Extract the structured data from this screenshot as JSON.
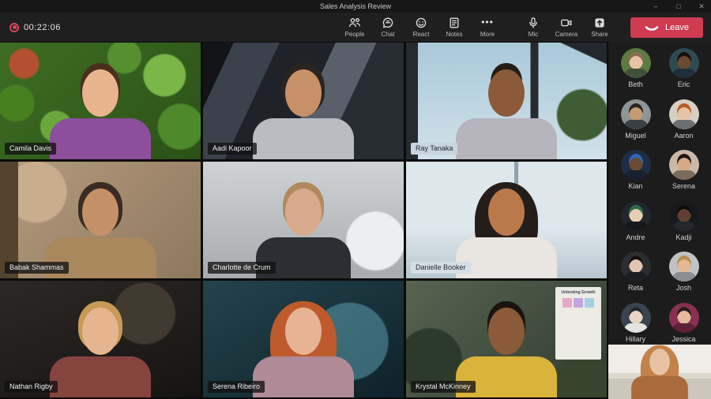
{
  "window": {
    "title": "Sales Analysis Review",
    "minimize": "–",
    "maximize": "□",
    "close": "✕"
  },
  "colors": {
    "leave_red": "#cf3b50",
    "record_red": "#d5495b",
    "titlebar_bg": "#171717",
    "toolbar_bg": "#1f1f1f"
  },
  "toolbar": {
    "timer": "00:22:06",
    "record_ring_style": "border-color:#d5495b",
    "record_dot_style": "background:#d5495b",
    "items": [
      {
        "label": "People",
        "icon": "people-icon"
      },
      {
        "label": "Chat",
        "icon": "chat-icon"
      },
      {
        "label": "React",
        "icon": "react-icon"
      },
      {
        "label": "Notes",
        "icon": "notes-icon"
      },
      {
        "label": "More",
        "icon": "more-icon",
        "glyph": "•••"
      }
    ],
    "devices": [
      {
        "label": "Mic",
        "icon": "mic-icon"
      },
      {
        "label": "Camera",
        "icon": "camera-icon"
      },
      {
        "label": "Share",
        "icon": "share-icon"
      }
    ],
    "leave_label": "Leave",
    "leave_style": "background:#cf3b50"
  },
  "grid": {
    "whiteboard_title": "Unlocking Growth",
    "tiles": [
      {
        "name": "Camila Davis",
        "style": "--scene:radial-gradient(circle at 12% 18%, #b2502f 0%, #b2502f 7%, rgba(0,0,0,0) 8%),radial-gradient(circle at 82% 28%, #7ab648 0%, #7ab648 11%, rgba(0,0,0,0) 12%),radial-gradient(circle at 28% 72%, #6aa83e 0%, #6aa83e 9%, rgba(0,0,0,0) 10%),radial-gradient(circle at 62% 12%, #558f2f 0%, #558f2f 10%, rgba(0,0,0,0) 11%),radial-gradient(circle at 90% 72%, #4e8a2c 0%, #4e8a2c 11%, rgba(0,0,0,0) 12%),radial-gradient(circle at 8% 52%, #47801f 0%, #47801f 9%, rgba(0,0,0,0) 10%),linear-gradient(135deg,#3e6d23,#2b5117);--skin:#e9b48d;--hair:#4a2f1d;--hairw:50px;--hairh:62px;--shirt:#8d4e9c"
      },
      {
        "name": "Aadi Kapoor",
        "style": "--scene:linear-gradient(115deg,#121418 0%,#121418 12%,#3c424b 12%,#3c424b 30%,#1f2329 30%,#1f2329 52%,#5a6069 52%,#5a6069 68%,#282c33 68%,#282c33 100%);--skin:#c89067;--hair:#2b2420;--hairw:54px;--hairh:64px;--shirt:#b9bdc2"
      },
      {
        "name": "Ray Tanaka",
        "style": "--scene:linear-gradient(90deg,#262b30 0%,#262b30 6%,rgba(0,0,0,0) 6%,rgba(0,0,0,0) 62%,#262b30 62%,#262b30 66%,rgba(0,0,0,0) 66%),linear-gradient(205deg,#23282e 0%,#23282e 10%,rgba(0,0,0,0) 10.5%),radial-gradient(circle at 88% 62%, #3f5d35 0%, #3f5d35 13%, rgba(0,0,0,0) 14%),linear-gradient(180deg,#a9c9d9,#d0e1e9);--skin:#8a5a3b;--hair:#241d16;--hairw:40px;--hairh:48px;--shirt:#b6b4bd;--tagbg:#c9d5de;--tagfg:#1d2530"
      },
      {
        "name": "Babak Shammas",
        "style": "--scene:linear-gradient(90deg,#53432f 0%,#53432f 9%,rgba(0,0,0,0) 9%),radial-gradient(circle at 18% 26%, #c9ae8d 0%, #c9ae8d 16%, rgba(0,0,0,0) 17%),linear-gradient(135deg,#b49b7f,#8d785e);--skin:#c69067;--hair:#382c24;--hairw:56px;--hairh:64px;--bodyw:142px;--shirt:#a8885c"
      },
      {
        "name": "Charlotte de Crum",
        "style": "--scene:radial-gradient(circle at 86% 68%, #eceef0 0%, #eceef0 15%, rgba(0,0,0,0) 16%),linear-gradient(180deg,#d0d3d5,#a7abae);--skin:#d9a98c;--hair:#b08a5c;--hairw:52px;--hairh:60px;--bodyw:120px;--shirt:#2b2e33"
      },
      {
        "name": "Danielle Booker",
        "style": "--scene:linear-gradient(90deg,rgba(0,0,0,0) 0%,rgba(0,0,0,0) 54%,#8fa3ad 54%,#8fa3ad 56%,rgba(0,0,0,0) 56%),linear-gradient(180deg,#dde7ec 0%,#dde7ec 58%,#b8c6ce 100%);--skin:#b9794b;--hair:#241d1a;--hairw:80px;--hairh:102px;--shirt:#e9e5e1;--tagbg:#d4dee4;--tagfg:#212834"
      },
      {
        "name": "Nathan Rigby",
        "style": "--scene:radial-gradient(circle at 72% 28%, #413a30 0%, #413a30 18%, rgba(0,0,0,0) 19%),linear-gradient(160deg,#2b2825,#161412);--skin:#e4b58f;--hair:#c89a55;--hairw:56px;--hairh:62px;--shirt:#86443e"
      },
      {
        "name": "Serena Ribeiro",
        "style": "--scene:radial-gradient(circle at 73% 52%, rgba(96,168,184,0.5) 0%, rgba(96,168,184,0.5) 24%, rgba(0,0,0,0) 25%),linear-gradient(150deg,#25434d,#0e2128);--skin:#e6b394;--hair:#bf5a2d;--hairw:84px;--hairh:104px;--shirt:#b08a96"
      },
      {
        "name": "Krystal McKinney",
        "style": "--scene:radial-gradient(circle at 12% 68%, #2c3a2c 0%, #2c3a2c 16%, rgba(0,0,0,0) 17%),radial-gradient(circle at 88% 88%, #37452f 0%, #37452f 14%, rgba(0,0,0,0) 15%),linear-gradient(135deg,#57644f,#313b31);--skin:#8a5a3b;--hair:#1a1410;--hairw:48px;--hairh:58px;--shirt:#d9b33a"
      }
    ]
  },
  "sidebar": {
    "participants": [
      {
        "name": "Beth",
        "style": "--abg:#5d7a42;--askin:#e8c3a8;--ahair:#8a6b4f;--ashirt:#40503a"
      },
      {
        "name": "Eric",
        "style": "--abg:#2e4a52;--askin:#6b4a33;--ahair:#15100d;--ashirt:#20303a"
      },
      {
        "name": "Miguel",
        "style": "--abg:#8f9497;--askin:#c79b72;--ahair:#2a2320;--ashirt:#3a3f44"
      },
      {
        "name": "Aaron",
        "style": "--abg:#d8cfc4;--askin:#e6c3a5;--ahair:#b85c28;--ashirt:#6b6f72"
      },
      {
        "name": "Kian",
        "style": "--abg:#1e2e46;--askin:#6b4a33;--ahair:#2e66b8;--ashirt:#17202e"
      },
      {
        "name": "Serena",
        "style": "--abg:#cbb9a8;--askin:#d8a987;--ahair:#1d1713;--ashirt:#7a6b5c"
      },
      {
        "name": "Andre",
        "style": "--abg:#20262b;--askin:#e8cdb5;--ahair:#2f6b4a;--ashirt:#15191c"
      },
      {
        "name": "Kadji",
        "style": "--abg:#17191c;--askin:#5f4030;--ahair:#0e0c0a;--ashirt:#24282c"
      },
      {
        "name": "Reta",
        "style": "--abg:#2a2e31;--askin:#e3c6b2;--ahair:#141110;--ashirt:#1c1f22"
      },
      {
        "name": "Josh",
        "style": "--abg:#bfc3c6;--askin:#e3b894;--ahair:#b88d4f;--ashirt:#8a8e91"
      },
      {
        "name": "Hillary",
        "style": "--abg:#3a4450;--askin:#e8d5c5;--ahair:#23282e;--ashirt:#e3e3e0"
      },
      {
        "name": "Jessica",
        "style": "--abg:#8a2f52;--askin:#e4b99c;--ahair:#2a1d18;--ashirt:#5e2238"
      }
    ]
  },
  "selfview": {
    "style": "--scene:linear-gradient(180deg,#f0ede8 0%,#f0ede8 52%,#ddd7cd 52%,#ddd7cd 62%,#cdc6ba 62%,#cdc6ba 100%);--skin:#e8c2a2;--hair:#c2824a;--hairw:86px;--hairh:108px;--shirt:#a96a3c"
  }
}
